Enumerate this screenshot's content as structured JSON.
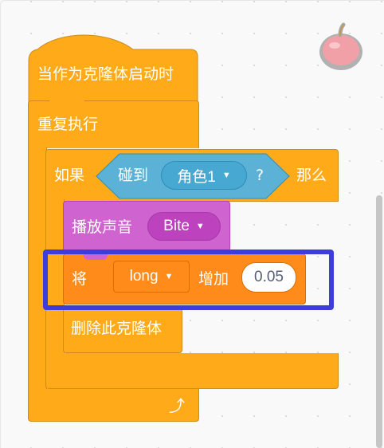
{
  "script": {
    "hat_label": "当作为克隆体启动时",
    "repeat_label": "重复执行",
    "if_label": "如果",
    "then_label": "那么",
    "touching_label": "碰到",
    "touching_target": "角色1",
    "touching_q": "?",
    "play_sound_label": "播放声音",
    "sound_name": "Bite",
    "change_label_1": "将",
    "variable_name": "long",
    "change_label_2": "增加",
    "change_value": "0.05",
    "delete_clone_label": "删除此克隆体"
  },
  "sprite": {
    "icon": "apple-icon"
  },
  "colors": {
    "control": "#ffab19",
    "sensing": "#5cb1d6",
    "sound": "#cf63cf",
    "variables": "#ff8c1a",
    "highlight": "#3d3dd9"
  }
}
